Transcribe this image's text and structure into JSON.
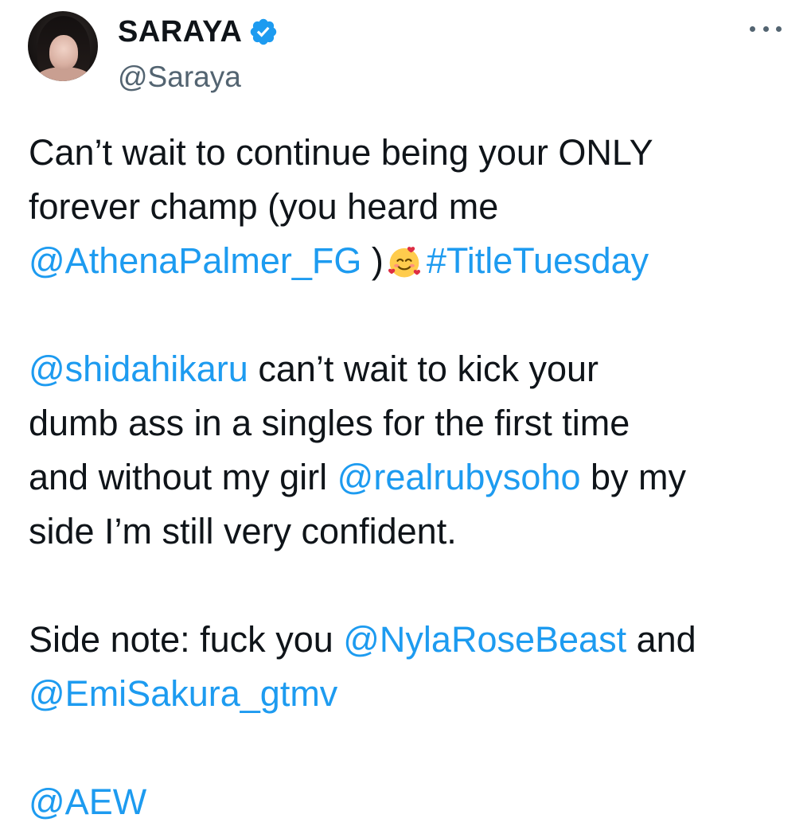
{
  "author": {
    "display_name": "SARAYA",
    "handle": "@Saraya",
    "verified": true
  },
  "colors": {
    "link": "#1d9bf0",
    "text": "#0f1419",
    "secondary": "#536471",
    "verified_badge": "#1d9bf0"
  },
  "icons": {
    "verified": "verified-badge-icon",
    "more": "more-options-icon",
    "emoji": "smiling-face-with-hearts-icon"
  },
  "tweet": {
    "p1": {
      "l1": "Can’t wait to continue being your ONLY",
      "l2": "forever champ (you heard me",
      "mention_athena": "@AthenaPalmer_FG",
      "paren_close": " )",
      "hashtag": "#TitleTuesday"
    },
    "p2": {
      "mention_shida": "@shidahikaru",
      "l1_rest": " can’t wait to kick your",
      "l2": "dumb ass in a singles for the first time",
      "l3_start": "and without my girl ",
      "mention_ruby": "@realrubysoho",
      "l3_end": " by my",
      "l4": "side I’m still very confident."
    },
    "p3": {
      "l1_start": "Side note: fuck you ",
      "mention_nyla": "@NylaRoseBeast",
      "l1_end": " and",
      "mention_emi": "@EmiSakura_gtmv"
    },
    "p4": {
      "mention_aew": "@AEW"
    }
  }
}
